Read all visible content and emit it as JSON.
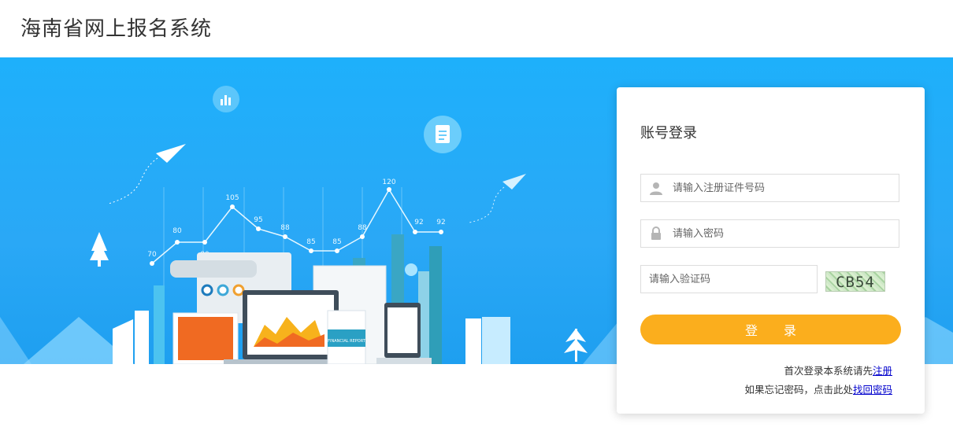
{
  "header": {
    "title": "海南省网上报名系统"
  },
  "banner": {
    "chart_values": [
      "70",
      "80",
      "80",
      "105",
      "95",
      "88",
      "85",
      "85",
      "88",
      "120",
      "92",
      "92"
    ],
    "report_label": "FINANCIAL REPORT"
  },
  "login": {
    "title": "账号登录",
    "id_placeholder": "请输入注册证件号码",
    "password_placeholder": "请输入密码",
    "captcha_placeholder": "请输入验证码",
    "captcha_text": "CB54",
    "submit_label": "登 录",
    "register_prefix": "首次登录本系统请先",
    "register_link": "注册",
    "forgot_prefix": "如果忘记密码，点击此处",
    "forgot_link": "找回密码"
  },
  "colors": {
    "banner": "#1eb0fb",
    "button": "#fbae1d",
    "link": "#0000cc"
  }
}
